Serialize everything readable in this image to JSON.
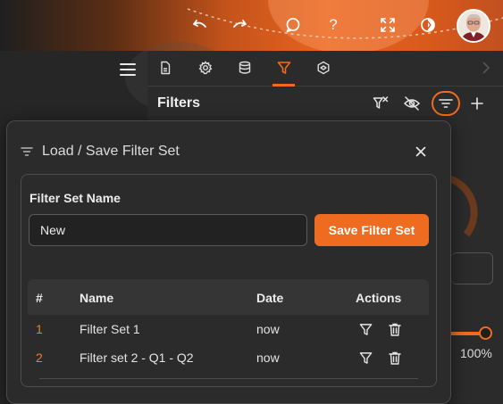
{
  "header": {
    "icons": [
      "undo-icon",
      "redo-icon",
      "chat-icon",
      "help-icon",
      "fullscreen-icon",
      "theme-toggle-icon"
    ],
    "help_glyph": "?",
    "accent_color": "#ef6c1e"
  },
  "sidebar": {
    "menu_icon": "hamburger-icon"
  },
  "tabs": {
    "items": [
      "document-tab",
      "settings-tab",
      "database-tab",
      "filter-tab",
      "plugins-tab"
    ],
    "active": "filter-tab"
  },
  "panel": {
    "title": "Filters",
    "percent": "100%",
    "slider_value": 1.0
  },
  "modal": {
    "title": "Load / Save Filter Set",
    "field_label": "Filter Set Name",
    "name_value": "New",
    "save_button": "Save Filter Set",
    "table": {
      "headers": {
        "num": "#",
        "name": "Name",
        "date": "Date",
        "actions": "Actions"
      },
      "rows": [
        {
          "num": "1",
          "name": "Filter Set 1",
          "date": "now"
        },
        {
          "num": "2",
          "name": "Filter set 2 - Q1 - Q2",
          "date": "now"
        }
      ]
    }
  }
}
